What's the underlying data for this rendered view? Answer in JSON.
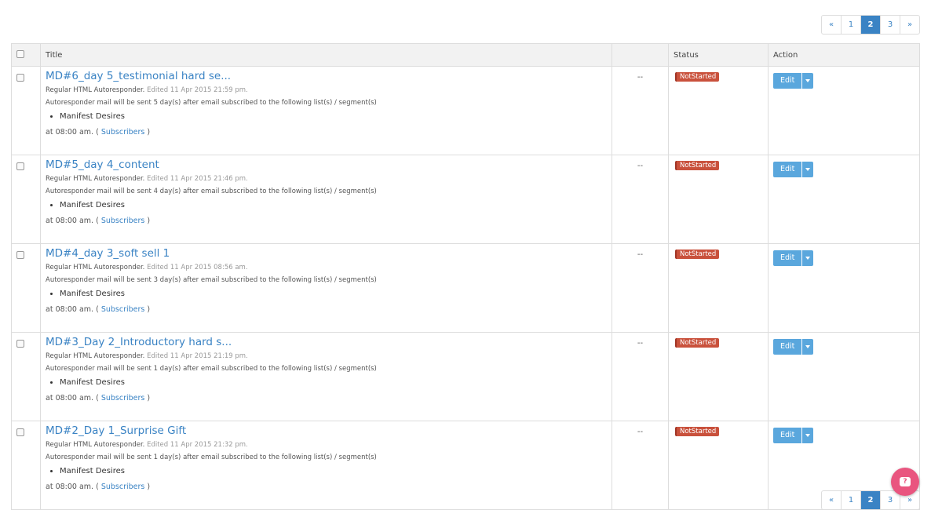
{
  "pagination": {
    "prev": "«",
    "pages": [
      "1",
      "2",
      "3"
    ],
    "active": "2",
    "next": "»"
  },
  "table": {
    "headers": {
      "title": "Title",
      "col3": "",
      "status": "Status",
      "action": "Action"
    },
    "rows": [
      {
        "title": "MD#6_day 5_testimonial hard se...",
        "type": "Regular HTML Autoresponder.",
        "edited": "Edited 11 Apr 2015 21:59 pm.",
        "description": "Autoresponder mail will be sent 5 day(s) after email subscribed to the following list(s) / segment(s)",
        "list": "Manifest Desires",
        "schedule_prefix": "at 08:00 am. (",
        "subscribers_link": "Subscribers",
        "schedule_suffix": ")",
        "col3": "--",
        "status": "NotStarted",
        "action": "Edit"
      },
      {
        "title": "MD#5_day 4_content",
        "type": "Regular HTML Autoresponder.",
        "edited": "Edited 11 Apr 2015 21:46 pm.",
        "description": "Autoresponder mail will be sent 4 day(s) after email subscribed to the following list(s) / segment(s)",
        "list": "Manifest Desires",
        "schedule_prefix": "at 08:00 am. (",
        "subscribers_link": "Subscribers",
        "schedule_suffix": ")",
        "col3": "--",
        "status": "NotStarted",
        "action": "Edit"
      },
      {
        "title": "MD#4_day 3_soft sell 1",
        "type": "Regular HTML Autoresponder.",
        "edited": "Edited 11 Apr 2015 08:56 am.",
        "description": "Autoresponder mail will be sent 3 day(s) after email subscribed to the following list(s) / segment(s)",
        "list": "Manifest Desires",
        "schedule_prefix": "at 08:00 am. (",
        "subscribers_link": "Subscribers",
        "schedule_suffix": ")",
        "col3": "--",
        "status": "NotStarted",
        "action": "Edit"
      },
      {
        "title": "MD#3_Day 2_Introductory hard s...",
        "type": "Regular HTML Autoresponder.",
        "edited": "Edited 11 Apr 2015 21:19 pm.",
        "description": "Autoresponder mail will be sent 1 day(s) after email subscribed to the following list(s) / segment(s)",
        "list": "Manifest Desires",
        "schedule_prefix": "at 08:00 am. (",
        "subscribers_link": "Subscribers",
        "schedule_suffix": ")",
        "col3": "--",
        "status": "NotStarted",
        "action": "Edit"
      },
      {
        "title": "MD#2_Day 1_Surprise Gift",
        "type": "Regular HTML Autoresponder.",
        "edited": "Edited 11 Apr 2015 21:32 pm.",
        "description": "Autoresponder mail will be sent 1 day(s) after email subscribed to the following list(s) / segment(s)",
        "list": "Manifest Desires",
        "schedule_prefix": "at 08:00 am. (",
        "subscribers_link": "Subscribers",
        "schedule_suffix": ")",
        "col3": "--",
        "status": "NotStarted",
        "action": "Edit"
      }
    ]
  },
  "help_button": {
    "icon": "help-chat-icon",
    "glyph": "?"
  },
  "colors": {
    "accent": "#3a83c4",
    "status_not_started": "#c9513c",
    "help": "#e9557f"
  }
}
